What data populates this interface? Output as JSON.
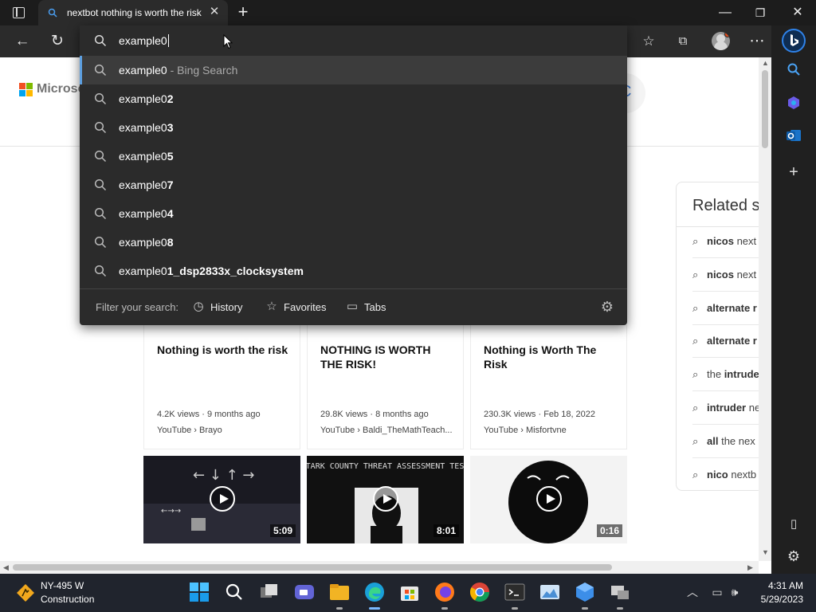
{
  "tab": {
    "title": "nextbot nothing is worth the risk"
  },
  "window": {
    "minimize": "—",
    "restore": "❐",
    "close": "✕"
  },
  "address": {
    "value": "example0"
  },
  "suggestions": [
    {
      "base": "example0",
      "suffix": " - Bing Search",
      "selected": true
    },
    {
      "base": "example0",
      "suffix": "2"
    },
    {
      "base": "example0",
      "suffix": "3"
    },
    {
      "base": "example0",
      "suffix": "5"
    },
    {
      "base": "example0",
      "suffix": "7"
    },
    {
      "base": "example0",
      "suffix": "4"
    },
    {
      "base": "example0",
      "suffix": "8"
    },
    {
      "base": "example0",
      "suffix": "1_dsp2833x_clocksystem"
    }
  ],
  "filter": {
    "label": "Filter your search:",
    "history": "History",
    "favorites": "Favorites",
    "tabs": "Tabs"
  },
  "page": {
    "brand": "Microsoft",
    "videos": [
      {
        "title": "Nothing is worth the risk",
        "meta": "4.2K views · 9 months ago",
        "source": "YouTube › Brayo"
      },
      {
        "title": "NOTHING IS WORTH THE RISK!",
        "meta": "29.8K views · 8 months ago",
        "source": "YouTube › Baldi_TheMathTeach..."
      },
      {
        "title": "Nothing is Worth The Risk",
        "meta": "230.3K views · Feb 18, 2022",
        "source": "YouTube › Misfortvne"
      }
    ],
    "thumbs": [
      {
        "duration": "5:09"
      },
      {
        "duration": "8:01",
        "caption": "STARK COUNTY THREAT ASSESSMENT TEST"
      },
      {
        "duration": "0:16"
      }
    ],
    "related": {
      "heading": "Related s",
      "items": [
        {
          "bold": "nicos",
          "rest": " next"
        },
        {
          "bold": "nicos",
          "rest": " next"
        },
        {
          "bold": "alternate r",
          "rest": ""
        },
        {
          "bold": "alternate r",
          "rest": ""
        },
        {
          "bold": "",
          "rest": "the ",
          "bold2": "intrude"
        },
        {
          "bold": "intruder",
          "rest": " ne"
        },
        {
          "bold": "all",
          "rest": " the nex"
        },
        {
          "bold": "nico",
          "rest": " nextb"
        }
      ]
    }
  },
  "taskbar": {
    "weather_line1": "NY-495 W",
    "weather_line2": "Construction",
    "time": "4:31 AM",
    "date": "5/29/2023"
  },
  "colors": {
    "accent": "#2f82e8",
    "titlebar": "#1c1c1c",
    "dropdown": "#2b2b2b",
    "taskbar": "#20242d"
  }
}
